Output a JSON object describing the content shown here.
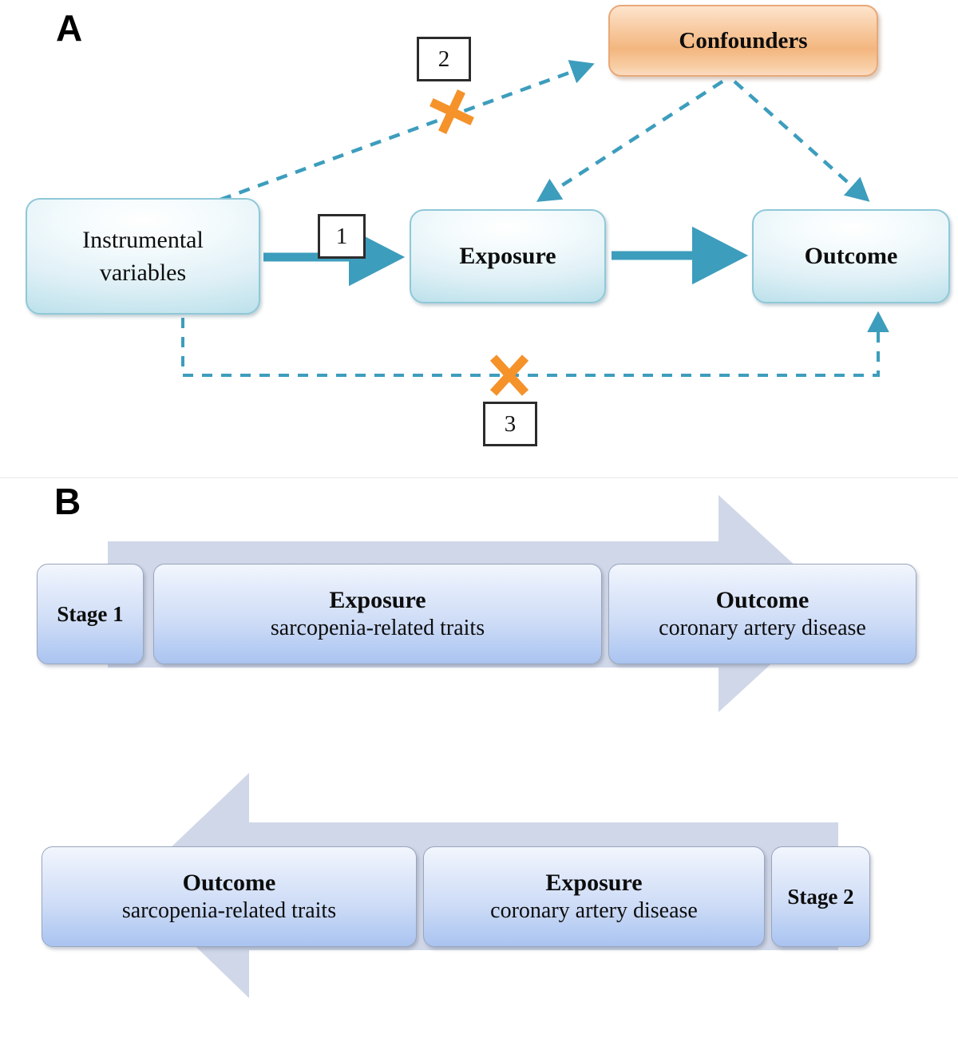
{
  "figure": {
    "panels": [
      {
        "id": "A",
        "letter": "A"
      },
      {
        "id": "B",
        "letter": "B"
      }
    ]
  },
  "panel_a": {
    "letter": "A",
    "nodes": {
      "instrumental_variables": {
        "line1": "Instrumental",
        "line2": "variables"
      },
      "exposure": {
        "label": "Exposure"
      },
      "outcome": {
        "label": "Outcome"
      },
      "confounders": {
        "label": "Confounders"
      }
    },
    "assumption_labels": {
      "one": "1",
      "two": "2",
      "three": "3"
    },
    "edges": [
      {
        "name": "iv-to-exposure",
        "from": "Instrumental variables",
        "to": "Exposure",
        "style": "solid",
        "label": "1",
        "blocked": false
      },
      {
        "name": "iv-to-confounders",
        "from": "Instrumental variables",
        "to": "Confounders",
        "style": "dashed",
        "label": "2",
        "blocked": true
      },
      {
        "name": "iv-to-outcome-direct",
        "from": "Instrumental variables",
        "to": "Outcome",
        "style": "dashed",
        "label": "3",
        "blocked": true
      },
      {
        "name": "exposure-to-outcome",
        "from": "Exposure",
        "to": "Outcome",
        "style": "solid",
        "label": "",
        "blocked": false
      },
      {
        "name": "confounders-to-exposure",
        "from": "Confounders",
        "to": "Exposure",
        "style": "dashed",
        "label": "",
        "blocked": false
      },
      {
        "name": "confounders-to-outcome",
        "from": "Confounders",
        "to": "Outcome",
        "style": "dashed",
        "label": "",
        "blocked": false
      }
    ],
    "colors": {
      "node_blue_border": "#8fc8d8",
      "node_blue_fill": "#cfe9f1",
      "confounder_orange_fill": "#f4bd8d",
      "confounder_orange_border": "#e8a878",
      "arrow_blue": "#3d9dbd",
      "block_marker_orange": "#f5922a",
      "label_box_border": "#2c2c2c"
    }
  },
  "panel_b": {
    "letter": "B",
    "stages": [
      {
        "name": "stage-1",
        "stage_label": "Stage 1",
        "direction": "forward",
        "boxes": [
          {
            "title": "Exposure",
            "subtitle": "sarcopenia-related traits"
          },
          {
            "title": "Outcome",
            "subtitle": "coronary artery disease"
          }
        ]
      },
      {
        "name": "stage-2",
        "stage_label": "Stage 2",
        "direction": "reverse",
        "boxes": [
          {
            "title": "Outcome",
            "subtitle": "sarcopenia-related traits"
          },
          {
            "title": "Exposure",
            "subtitle": "coronary artery disease"
          }
        ]
      }
    ],
    "colors": {
      "box_fill_top": "#eef3fd",
      "box_fill_bottom": "#aac4f0",
      "box_border": "#9aa6bd",
      "arrow_fill": "#cfd6e6"
    }
  }
}
